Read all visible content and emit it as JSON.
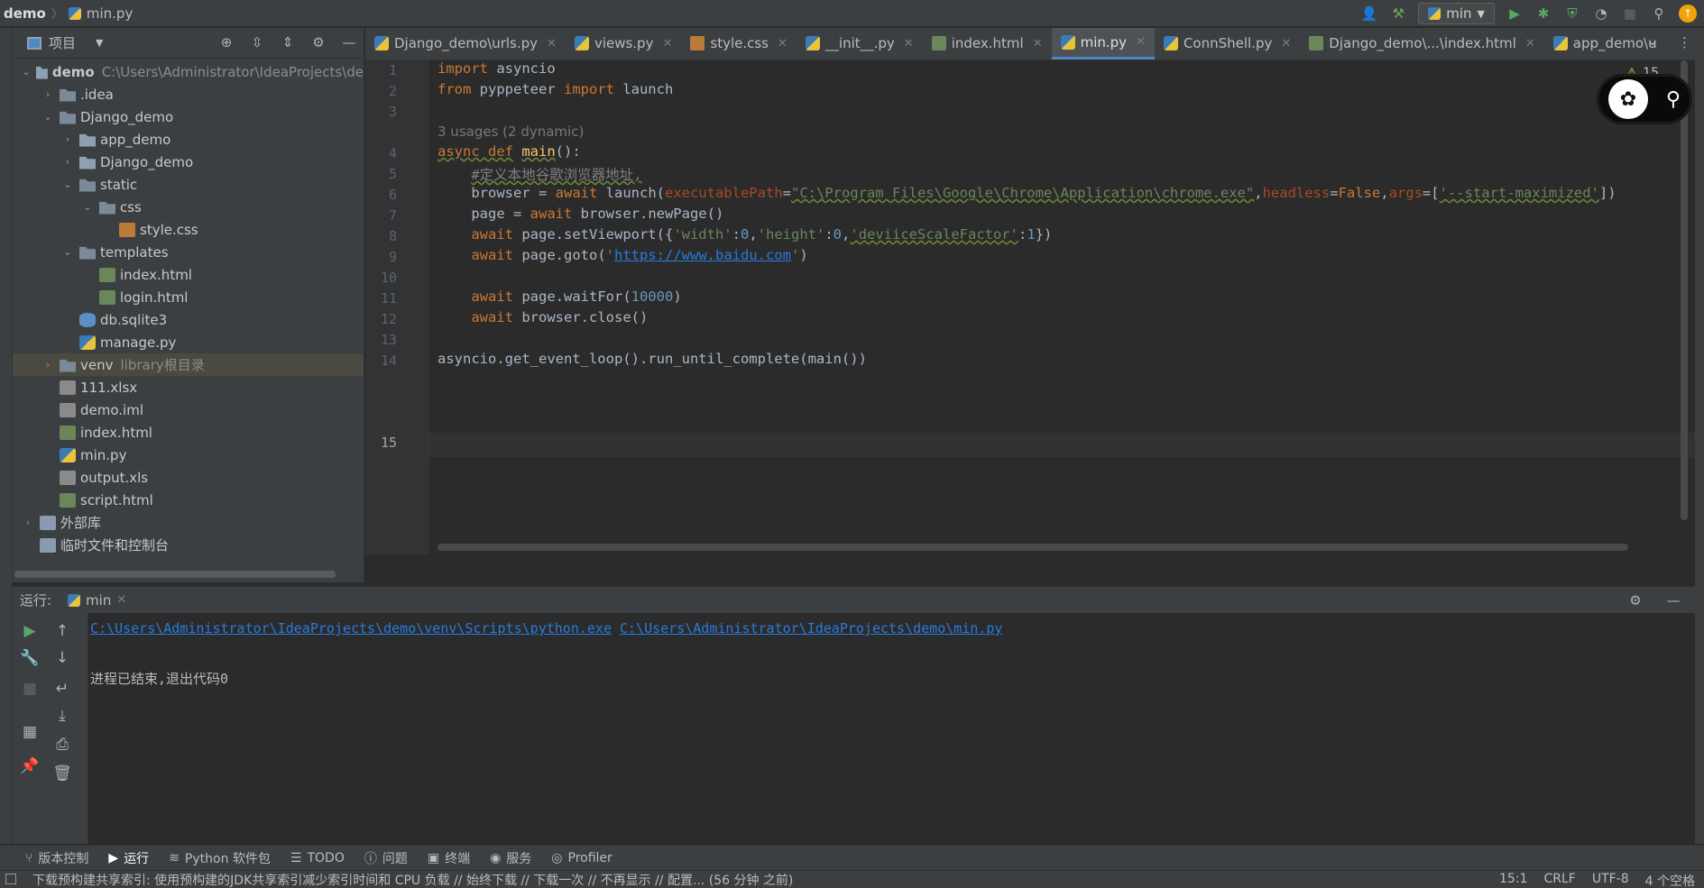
{
  "navbar": {
    "project": "demo",
    "file": "min.py",
    "run_config": "min"
  },
  "project_panel": {
    "title": "项目",
    "tree": [
      {
        "label": "demo",
        "path": "C:\\Users\\Administrator\\IdeaProjects\\de",
        "depth": 0,
        "arrow": "v",
        "icon": "folder-dark"
      },
      {
        "label": ".idea",
        "depth": 1,
        "arrow": ">",
        "icon": "folder"
      },
      {
        "label": "Django_demo",
        "depth": 1,
        "arrow": "v",
        "icon": "folder"
      },
      {
        "label": "app_demo",
        "depth": 2,
        "arrow": ">",
        "icon": "folder-dark"
      },
      {
        "label": "Django_demo",
        "depth": 2,
        "arrow": ">",
        "icon": "folder-dark"
      },
      {
        "label": "static",
        "depth": 2,
        "arrow": "v",
        "icon": "folder"
      },
      {
        "label": "css",
        "depth": 3,
        "arrow": "v",
        "icon": "folder"
      },
      {
        "label": "style.css",
        "depth": 4,
        "arrow": "",
        "icon": "file-css"
      },
      {
        "label": "templates",
        "depth": 2,
        "arrow": "v",
        "icon": "folder"
      },
      {
        "label": "index.html",
        "depth": 3,
        "arrow": "",
        "icon": "file-html"
      },
      {
        "label": "login.html",
        "depth": 3,
        "arrow": "",
        "icon": "file-html"
      },
      {
        "label": "db.sqlite3",
        "depth": 2,
        "arrow": "",
        "icon": "file-db"
      },
      {
        "label": "manage.py",
        "depth": 2,
        "arrow": "",
        "icon": "file-py"
      },
      {
        "label": "venv",
        "path": "library根目录",
        "depth": 1,
        "arrow": ">",
        "icon": "folder",
        "selected": true
      },
      {
        "label": "111.xlsx",
        "depth": 1,
        "arrow": "",
        "icon": "file-x"
      },
      {
        "label": "demo.iml",
        "depth": 1,
        "arrow": "",
        "icon": "file-x"
      },
      {
        "label": "index.html",
        "depth": 1,
        "arrow": "",
        "icon": "file-html"
      },
      {
        "label": "min.py",
        "depth": 1,
        "arrow": "",
        "icon": "file-py"
      },
      {
        "label": "output.xls",
        "depth": 1,
        "arrow": "",
        "icon": "file-x"
      },
      {
        "label": "script.html",
        "depth": 1,
        "arrow": "",
        "icon": "file-html"
      },
      {
        "label": "外部库",
        "depth": 0,
        "arrow": ">",
        "icon": "lib"
      },
      {
        "label": "临时文件和控制台",
        "depth": 0,
        "arrow": "",
        "icon": "lib"
      }
    ]
  },
  "tabs": [
    {
      "label": "Django_demo\\urls.py",
      "icon": "file-py"
    },
    {
      "label": "views.py",
      "icon": "file-py"
    },
    {
      "label": "style.css",
      "icon": "file-css"
    },
    {
      "label": "__init__.py",
      "icon": "file-py"
    },
    {
      "label": "index.html",
      "icon": "file-html"
    },
    {
      "label": "min.py",
      "icon": "file-py",
      "active": true
    },
    {
      "label": "ConnShell.py",
      "icon": "file-py"
    },
    {
      "label": "Django_demo\\...\\index.html",
      "icon": "file-html"
    },
    {
      "label": "app_demo\\u",
      "icon": "file-py"
    }
  ],
  "editor": {
    "warning_count": "15",
    "usages_hint": "3 usages (2 dynamic)",
    "lines": [
      "1",
      "2",
      "3",
      "4",
      "5",
      "6",
      "7",
      "8",
      "9",
      "10",
      "11",
      "12",
      "13",
      "14",
      "15"
    ],
    "current_line": "15"
  },
  "run_panel": {
    "label": "运行:",
    "tab": "min",
    "cmd_python": "C:\\Users\\Administrator\\IdeaProjects\\demo\\venv\\Scripts\\python.exe",
    "cmd_script": "C:\\Users\\Administrator\\IdeaProjects\\demo\\min.py",
    "exit_msg": "进程已结束,退出代码0"
  },
  "bottom_tools": [
    {
      "label": "版本控制",
      "icon": "branch-icon"
    },
    {
      "label": "运行",
      "icon": "play-icon",
      "active": true
    },
    {
      "label": "Python 软件包",
      "icon": "layers-icon"
    },
    {
      "label": "TODO",
      "icon": "list-icon"
    },
    {
      "label": "问题",
      "icon": "info-icon"
    },
    {
      "label": "终端",
      "icon": "terminal-icon"
    },
    {
      "label": "服务",
      "icon": "services-icon"
    },
    {
      "label": "Profiler",
      "icon": "profiler-icon"
    }
  ],
  "statusbar": {
    "message": "下载预构建共享索引: 使用预构建的JDK共享索引减少索引时间和 CPU 负载 // 始终下载 // 下载一次 // 不再显示 // 配置... (56 分钟 之前)",
    "position": "15:1",
    "line_sep": "CRLF",
    "encoding": "UTF-8",
    "indent": "4 个空格"
  },
  "colors": {
    "accent": "#4a88c7",
    "keyword": "#cc7832",
    "string": "#6a8759",
    "number": "#6897bb",
    "function": "#ffc66d"
  }
}
